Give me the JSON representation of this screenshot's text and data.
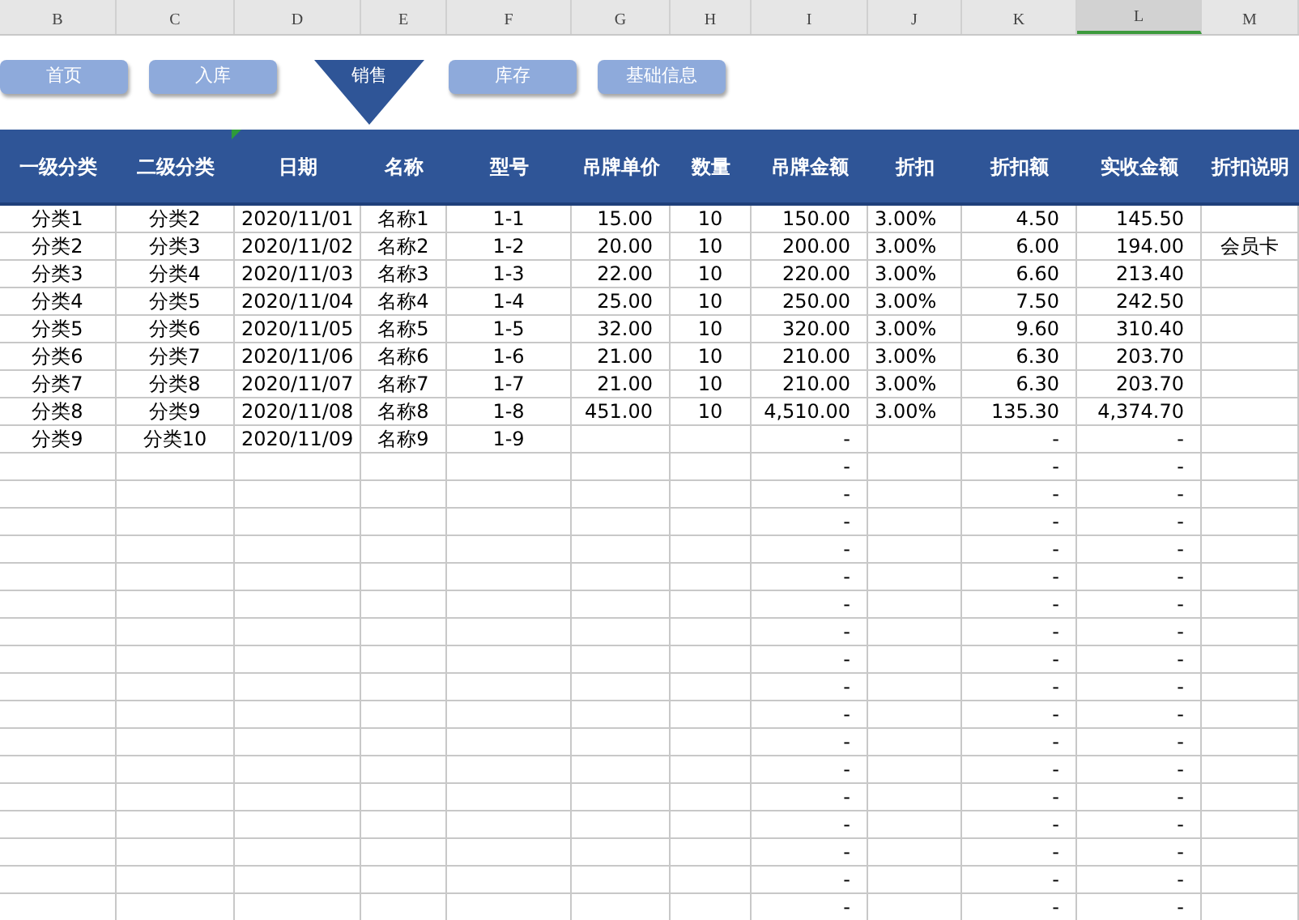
{
  "column_letters": [
    {
      "label": "B",
      "selected": false
    },
    {
      "label": "C",
      "selected": false
    },
    {
      "label": "D",
      "selected": false
    },
    {
      "label": "E",
      "selected": false
    },
    {
      "label": "F",
      "selected": false
    },
    {
      "label": "G",
      "selected": false
    },
    {
      "label": "H",
      "selected": false
    },
    {
      "label": "I",
      "selected": false
    },
    {
      "label": "J",
      "selected": false
    },
    {
      "label": "K",
      "selected": false
    },
    {
      "label": "L",
      "selected": true
    },
    {
      "label": "M",
      "selected": false
    }
  ],
  "nav_buttons": [
    {
      "label": "首页",
      "selected": false
    },
    {
      "label": "入库",
      "selected": false
    },
    {
      "label": "销售",
      "selected": true
    },
    {
      "label": "库存",
      "selected": false
    },
    {
      "label": "基础信息",
      "selected": false
    }
  ],
  "table": {
    "columns": [
      "一级分类",
      "二级分类",
      "日期",
      "名称",
      "型号",
      "吊牌单价",
      "数量",
      "吊牌金额",
      "折扣",
      "折扣额",
      "实收金额",
      "折扣说明"
    ],
    "rows": [
      {
        "category1": "分类1",
        "category2": "分类2",
        "date": "2020/11/01",
        "name": "名称1",
        "model": "1-1",
        "tag_price": "15.00",
        "qty": "10",
        "tag_amount": "150.00",
        "discount": "3.00%",
        "discount_amount": "4.50",
        "net_amount": "145.50"
      },
      {
        "category1": "分类2",
        "category2": "分类3",
        "date": "2020/11/02",
        "name": "名称2",
        "model": "1-2",
        "tag_price": "20.00",
        "qty": "10",
        "tag_amount": "200.00",
        "discount": "3.00%",
        "discount_amount": "6.00",
        "net_amount": "194.00",
        "discount_note": "会员卡"
      },
      {
        "category1": "分类3",
        "category2": "分类4",
        "date": "2020/11/03",
        "name": "名称3",
        "model": "1-3",
        "tag_price": "22.00",
        "qty": "10",
        "tag_amount": "220.00",
        "discount": "3.00%",
        "discount_amount": "6.60",
        "net_amount": "213.40"
      },
      {
        "category1": "分类4",
        "category2": "分类5",
        "date": "2020/11/04",
        "name": "名称4",
        "model": "1-4",
        "tag_price": "25.00",
        "qty": "10",
        "tag_amount": "250.00",
        "discount": "3.00%",
        "discount_amount": "7.50",
        "net_amount": "242.50"
      },
      {
        "category1": "分类5",
        "category2": "分类6",
        "date": "2020/11/05",
        "name": "名称5",
        "model": "1-5",
        "tag_price": "32.00",
        "qty": "10",
        "tag_amount": "320.00",
        "discount": "3.00%",
        "discount_amount": "9.60",
        "net_amount": "310.40"
      },
      {
        "category1": "分类6",
        "category2": "分类7",
        "date": "2020/11/06",
        "name": "名称6",
        "model": "1-6",
        "tag_price": "21.00",
        "qty": "10",
        "tag_amount": "210.00",
        "discount": "3.00%",
        "discount_amount": "6.30",
        "net_amount": "203.70"
      },
      {
        "category1": "分类7",
        "category2": "分类8",
        "date": "2020/11/07",
        "name": "名称7",
        "model": "1-7",
        "tag_price": "21.00",
        "qty": "10",
        "tag_amount": "210.00",
        "discount": "3.00%",
        "discount_amount": "6.30",
        "net_amount": "203.70"
      },
      {
        "category1": "分类8",
        "category2": "分类9",
        "date": "2020/11/08",
        "name": "名称8",
        "model": "1-8",
        "tag_price": "451.00",
        "qty": "10",
        "tag_amount": "4,510.00",
        "discount": "3.00%",
        "discount_amount": "135.30",
        "net_amount": "4,374.70"
      },
      {
        "category1": "分类9",
        "category2": "分类10",
        "date": "2020/11/09",
        "name": "名称9",
        "model": "1-9",
        "tag_amount": "-",
        "discount_amount": "-",
        "net_amount": "-"
      },
      {
        "tag_amount": "-",
        "discount_amount": "-",
        "net_amount": "-"
      },
      {
        "tag_amount": "-",
        "discount_amount": "-",
        "net_amount": "-"
      },
      {
        "tag_amount": "-",
        "discount_amount": "-",
        "net_amount": "-"
      },
      {
        "tag_amount": "-",
        "discount_amount": "-",
        "net_amount": "-"
      },
      {
        "tag_amount": "-",
        "discount_amount": "-",
        "net_amount": "-"
      },
      {
        "tag_amount": "-",
        "discount_amount": "-",
        "net_amount": "-"
      },
      {
        "tag_amount": "-",
        "discount_amount": "-",
        "net_amount": "-"
      },
      {
        "tag_amount": "-",
        "discount_amount": "-",
        "net_amount": "-"
      },
      {
        "tag_amount": "-",
        "discount_amount": "-",
        "net_amount": "-"
      },
      {
        "tag_amount": "-",
        "discount_amount": "-",
        "net_amount": "-"
      },
      {
        "tag_amount": "-",
        "discount_amount": "-",
        "net_amount": "-"
      },
      {
        "tag_amount": "-",
        "discount_amount": "-",
        "net_amount": "-"
      },
      {
        "tag_amount": "-",
        "discount_amount": "-",
        "net_amount": "-"
      },
      {
        "tag_amount": "-",
        "discount_amount": "-",
        "net_amount": "-"
      },
      {
        "tag_amount": "-",
        "discount_amount": "-",
        "net_amount": "-"
      },
      {
        "tag_amount": "-",
        "discount_amount": "-",
        "net_amount": "-"
      },
      {
        "tag_amount": "-",
        "discount_amount": "-",
        "net_amount": "-"
      }
    ]
  }
}
